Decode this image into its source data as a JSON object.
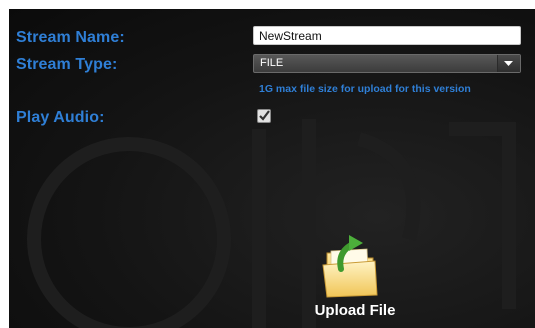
{
  "form": {
    "stream_name_label": "Stream Name:",
    "stream_name_value": "NewStream",
    "stream_type_label": "Stream Type:",
    "stream_type_selected": "FILE",
    "upload_hint": "1G max file size for upload for this version",
    "play_audio_label": "Play Audio:",
    "play_audio_checked": true
  },
  "upload": {
    "label": "Upload File",
    "icon": "upload-folder-icon"
  },
  "colors": {
    "label_blue": "#2f7fd6",
    "panel_bg": "#141414",
    "text_white": "#ffffff"
  }
}
